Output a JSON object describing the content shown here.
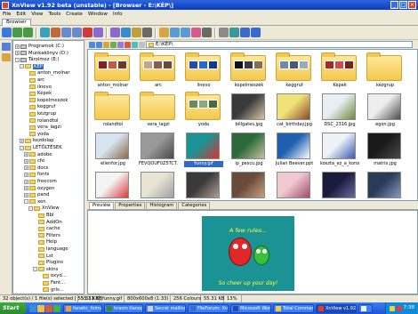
{
  "window": {
    "title": "XnView v1.92 beta (unstable) - [Browser - E:\\KÉP\\]",
    "controls": {
      "minimize": "_",
      "maximize": "□",
      "close": "×"
    }
  },
  "menu": [
    "File",
    "Edit",
    "View",
    "Tools",
    "Create",
    "Window",
    "Info"
  ],
  "tabs": [
    "Browser"
  ],
  "toolbar_icons": [
    "home-icon",
    "back-icon",
    "forward-icon",
    "refresh-icon",
    "cut-icon",
    "copy-icon",
    "paste-icon",
    "delete-icon",
    "rotate-icon",
    "rotate-icon",
    "view-icon",
    "filter-icon",
    "sort-icon",
    "thumbs-icon",
    "details-icon",
    "list-icon",
    "slideshow-icon",
    "print-icon",
    "settings-icon",
    "capture-icon",
    "web-icon",
    "help-icon"
  ],
  "path": {
    "value": "E:\\KÉP\\"
  },
  "tree": [
    {
      "label": "Programok (C:)",
      "depth": 1,
      "expander": "+",
      "icon": "drive"
    },
    {
      "label": "Munkakönyv (D:)",
      "depth": 1,
      "expander": "+",
      "icon": "drive"
    },
    {
      "label": "Tárolmez (E:)",
      "depth": 1,
      "expander": "-",
      "icon": "drive"
    },
    {
      "label": "KÉP",
      "depth": 2,
      "expander": "-",
      "icon": "folder",
      "selected": true
    },
    {
      "label": "anton_molnar",
      "depth": 3,
      "expander": "",
      "icon": "folder"
    },
    {
      "label": "arc",
      "depth": 3,
      "expander": "",
      "icon": "folder"
    },
    {
      "label": "ilnevo",
      "depth": 3,
      "expander": "",
      "icon": "folder"
    },
    {
      "label": "Képek",
      "depth": 3,
      "expander": "",
      "icon": "folder"
    },
    {
      "label": "kopelmeszek",
      "depth": 3,
      "expander": "",
      "icon": "folder"
    },
    {
      "label": "keggruf",
      "depth": 3,
      "expander": "",
      "icon": "folder"
    },
    {
      "label": "kézgrup",
      "depth": 3,
      "expander": "",
      "icon": "folder"
    },
    {
      "label": "rolandtol",
      "depth": 3,
      "expander": "",
      "icon": "folder"
    },
    {
      "label": "vera_lagzi",
      "depth": 3,
      "expander": "",
      "icon": "folder"
    },
    {
      "label": "yoda",
      "depth": 3,
      "expander": "",
      "icon": "folder"
    },
    {
      "label": "kezdolap",
      "depth": 2,
      "expander": "+",
      "icon": "folder"
    },
    {
      "label": "LETÖLTÉSEK",
      "depth": 2,
      "expander": "-",
      "icon": "folder"
    },
    {
      "label": "adobe",
      "depth": 3,
      "expander": "+",
      "icon": "folder"
    },
    {
      "label": "cfo",
      "depth": 3,
      "expander": "+",
      "icon": "folder"
    },
    {
      "label": "docs",
      "depth": 3,
      "expander": "+",
      "icon": "folder"
    },
    {
      "label": "fonts",
      "depth": 3,
      "expander": "+",
      "icon": "folder"
    },
    {
      "label": "freecom",
      "depth": 3,
      "expander": "+",
      "icon": "folder"
    },
    {
      "label": "oxygen",
      "depth": 3,
      "expander": "+",
      "icon": "folder"
    },
    {
      "label": "pand",
      "depth": 3,
      "expander": "+",
      "icon": "folder"
    },
    {
      "label": "xen",
      "depth": 3,
      "expander": "-",
      "icon": "folder"
    },
    {
      "label": "XnView",
      "depth": 4,
      "expander": "-",
      "icon": "folder"
    },
    {
      "label": "Bbl",
      "depth": 5,
      "expander": "",
      "icon": "folder"
    },
    {
      "label": "AddOn",
      "depth": 5,
      "expander": "",
      "icon": "folder"
    },
    {
      "label": "cache",
      "depth": 5,
      "expander": "",
      "icon": "folder"
    },
    {
      "label": "Filters",
      "depth": 5,
      "expander": "",
      "icon": "folder"
    },
    {
      "label": "Help",
      "depth": 5,
      "expander": "",
      "icon": "folder"
    },
    {
      "label": "language",
      "depth": 5,
      "expander": "",
      "icon": "folder"
    },
    {
      "label": "Lst",
      "depth": 5,
      "expander": "",
      "icon": "folder"
    },
    {
      "label": "Plugins",
      "depth": 5,
      "expander": "",
      "icon": "folder"
    },
    {
      "label": "skins",
      "depth": 5,
      "expander": "-",
      "icon": "folder"
    },
    {
      "label": "oxyd...",
      "depth": 6,
      "expander": "",
      "icon": "folder"
    },
    {
      "label": "Fant...",
      "depth": 6,
      "expander": "",
      "icon": "folder"
    },
    {
      "label": "gris...",
      "depth": 6,
      "expander": "",
      "icon": "folder"
    }
  ],
  "thumbnails": [
    {
      "label": "anton_molnar",
      "kind": "folder",
      "colors": [
        "#8a1f1f",
        "#c45b3a",
        "#6e3b2a"
      ]
    },
    {
      "label": "arc",
      "kind": "folder",
      "colors": [
        "#c2a58a",
        "#8d5b4a",
        "#6b4a3b"
      ]
    },
    {
      "label": "ilnevo",
      "kind": "folder",
      "colors": [
        "#224fa8",
        "#2a67c9",
        "#14398a"
      ]
    },
    {
      "label": "kopelmeszek",
      "kind": "folder",
      "colors": [
        "#111111",
        "#3b3b3b",
        "#8b6d4c"
      ]
    },
    {
      "label": "keggruf",
      "kind": "folder",
      "colors": [
        "#6e8aa9",
        "#4b5a70",
        "#9aaabb"
      ]
    },
    {
      "label": "Képek",
      "kind": "folder",
      "colors": [
        "#a62a2a",
        "#d44a4a",
        "#7e1e1e"
      ]
    },
    {
      "label": "kézgrup",
      "kind": "folder",
      "colors": [
        "#f2c94c",
        "#f2c94c",
        "#f2c94c"
      ]
    },
    {
      "label": "rolandtol",
      "kind": "folder",
      "colors": [
        "#f2c94c",
        "#f2c94c",
        "#f2c94c"
      ]
    },
    {
      "label": "vera_lagzi",
      "kind": "folder",
      "colors": [
        "#f2c94c",
        "#f2c94c",
        "#f2c94c"
      ]
    },
    {
      "label": "yoda",
      "kind": "folder",
      "colors": [
        "#6b8a5a",
        "#8aa87a",
        "#4a6a3a"
      ]
    },
    {
      "label": "billgates.jpg",
      "kind": "photo",
      "colors": [
        "#3a3a3a",
        "#d6c7a9"
      ]
    },
    {
      "label": "cat_birthday.jpg",
      "kind": "photo",
      "colors": [
        "#f0e27a",
        "#8a4a2a"
      ]
    },
    {
      "label": "DSC_2316.jpg",
      "kind": "photo",
      "colors": [
        "#e8eef2",
        "#6d8a3a"
      ]
    },
    {
      "label": "egon.jpg",
      "kind": "photo",
      "colors": [
        "#eeeeee",
        "#4a4a4a"
      ]
    },
    {
      "label": "ellenfor.jpg",
      "kind": "photo",
      "colors": [
        "#d8e4ef",
        "#8a6a4a"
      ]
    },
    {
      "label": "FEVQOUF0Z5TCT...",
      "kind": "photo",
      "colors": [
        "#9a9a9a",
        "#4a4a4a"
      ]
    },
    {
      "label": "funny.gif",
      "kind": "photo",
      "colors": [
        "#1b9394",
        "#e03030"
      ],
      "selected": true
    },
    {
      "label": "ip_pescu.jpg",
      "kind": "photo",
      "colors": [
        "#2a6a3a",
        "#c8c0a0"
      ]
    },
    {
      "label": "Julian Beever.ppt",
      "kind": "photo",
      "colors": [
        "#1e5fb0",
        "#ffffff"
      ]
    },
    {
      "label": "koszta_ez_a_koron...",
      "kind": "photo",
      "colors": [
        "#eef2f6",
        "#3a5ab0"
      ]
    },
    {
      "label": "matrix.jpg",
      "kind": "photo",
      "colors": [
        "#1a1a1a",
        "#4a4a4a"
      ]
    },
    {
      "label": "",
      "kind": "photo",
      "colors": [
        "#f4f4f4",
        "#d83a3a"
      ]
    },
    {
      "label": "",
      "kind": "photo",
      "colors": [
        "#e8e4d4",
        "#a0a0a0"
      ]
    },
    {
      "label": "",
      "kind": "photo",
      "colors": [
        "#3a3a3a",
        "#b0a090"
      ]
    },
    {
      "label": "",
      "kind": "photo",
      "colors": [
        "#6a4a3a",
        "#c8a080"
      ]
    },
    {
      "label": "",
      "kind": "photo",
      "colors": [
        "#f0c8d0",
        "#a04a6a"
      ]
    },
    {
      "label": "",
      "kind": "photo",
      "colors": [
        "#1a1a3a",
        "#6a6aa0"
      ]
    },
    {
      "label": "",
      "kind": "photo",
      "colors": [
        "#2a3a5a",
        "#8a9ac0"
      ]
    },
    {
      "label": "",
      "kind": "photo",
      "colors": [
        "#b02020",
        "#f0f0f0"
      ]
    }
  ],
  "preview": {
    "tabs": [
      "Preview",
      "Properties",
      "Histogram",
      "Categories"
    ],
    "active_tab": "Preview",
    "image_text_top": "A few rules...",
    "image_text_bottom": "So cheer up your day!"
  },
  "status": {
    "objects": "32 object(s) / 1 file(s) selected [ 55.31 KB ]",
    "size": "55.31 KB",
    "filename": "funny.gif",
    "dims": "800x600x8 (1.33)",
    "colors": "256 Colours",
    "filesize": "55.31 KB",
    "zoom": "13%"
  },
  "taskbar": {
    "start": "Start",
    "quick_icons": [
      "ie-icon",
      "folder-icon",
      "media-icon",
      "desktop-icon"
    ],
    "tasks": [
      {
        "label": "fanatic_folmagok...",
        "icon_color": "#f0a030",
        "width": 44
      },
      {
        "label": "hrasm tlanogatás ...",
        "icon_color": "#3a8a3a",
        "width": 44
      },
      {
        "label": "Secret mailing lists...",
        "icon_color": "#d0d0d0",
        "width": 46
      },
      {
        "label": "FileForum: XnView ...",
        "icon_color": "#3a6ad0",
        "width": 46
      },
      {
        "label": "Microsoft Word",
        "icon_color": "#2a4ab0",
        "width": 46
      },
      {
        "label": "Total Commander ...",
        "icon_color": "#f0d040",
        "width": 46
      },
      {
        "label": "XnView v1.92 ...",
        "icon_color": "#e04020",
        "width": 46,
        "active": true
      },
      {
        "label": "",
        "icon_color": "#f0f0f0",
        "width": 16
      }
    ],
    "clock": "7:38"
  }
}
